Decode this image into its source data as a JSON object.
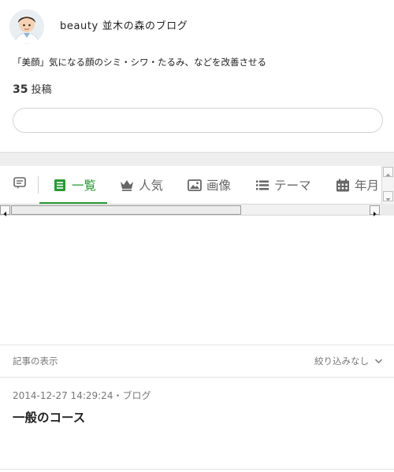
{
  "blog": {
    "title": "beauty 並木の森のブログ",
    "description": "「美顔」気になる顔のシミ・シワ・たるみ、などを改善させる",
    "post_count": "35",
    "post_count_label": "投稿"
  },
  "search": {
    "value": "",
    "placeholder": ""
  },
  "tabs": [
    {
      "label": "",
      "icon": "comment-icon"
    },
    {
      "label": "一覧",
      "icon": "list-icon",
      "active": true
    },
    {
      "label": "人気",
      "icon": "crown-icon"
    },
    {
      "label": "画像",
      "icon": "image-icon"
    },
    {
      "label": "テーマ",
      "icon": "menu-icon"
    },
    {
      "label": "年月",
      "icon": "calendar-icon"
    }
  ],
  "filter": {
    "label": "記事の表示",
    "selected": "絞り込みなし"
  },
  "articles": [
    {
      "meta": "2014-12-27 14:29:24・ブログ",
      "title": "一般のコース"
    }
  ],
  "colors": {
    "accent": "#279b34",
    "text": "#333333",
    "muted": "#777777",
    "border": "#e3e3e3",
    "band": "#eeeeee"
  }
}
